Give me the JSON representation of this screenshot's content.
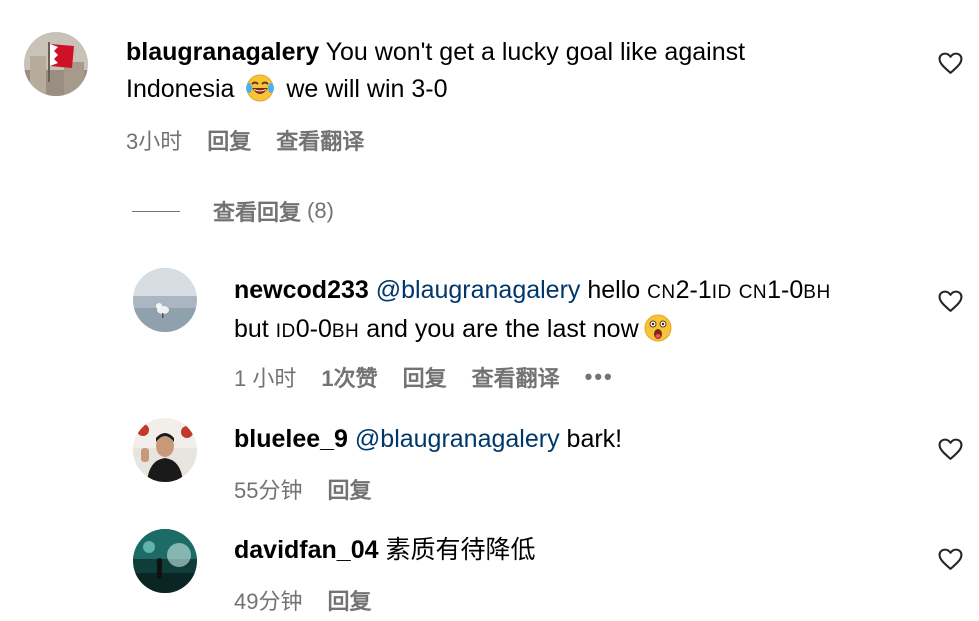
{
  "comments": [
    {
      "username": "blaugranagalery",
      "text_1": "You won't get a lucky goal like against",
      "text_2": "Indonesia",
      "emoji": "rolling-on-floor-laughing-emoji",
      "text_3": "we will win 3-0",
      "time": "3小时",
      "reply_label": "回复",
      "translate_label": "查看翻译"
    }
  ],
  "view_replies": {
    "label": "查看回复",
    "count": "(8)"
  },
  "replies": [
    {
      "username": "newcod233",
      "mention": "@blaugranagalery",
      "text_1": "hello",
      "cn1": "CN",
      "score1": "2-1",
      "id1": "ID",
      "cn2": "CN",
      "score2": "1-0",
      "bh1": "BH",
      "text_2": "but",
      "id2": "ID",
      "score3": "0-0",
      "bh2": "BH",
      "text_3": "and you are the last now",
      "emoji": "astonished-face-emoji",
      "time": "1 小时",
      "likes": "1次赞",
      "reply_label": "回复",
      "translate_label": "查看翻译",
      "more": "•••"
    },
    {
      "username": "bluelee_9",
      "mention": "@blaugranagalery",
      "text": "bark!",
      "time": "55分钟",
      "reply_label": "回复"
    },
    {
      "username": "davidfan_04",
      "text": "素质有待降低",
      "time": "49分钟",
      "reply_label": "回复"
    }
  ],
  "icons": {
    "like": "heart-outline-icon",
    "more": "more-dots-icon"
  },
  "colors": {
    "meta": "#737373",
    "mention": "#00376b",
    "text": "#000000"
  }
}
